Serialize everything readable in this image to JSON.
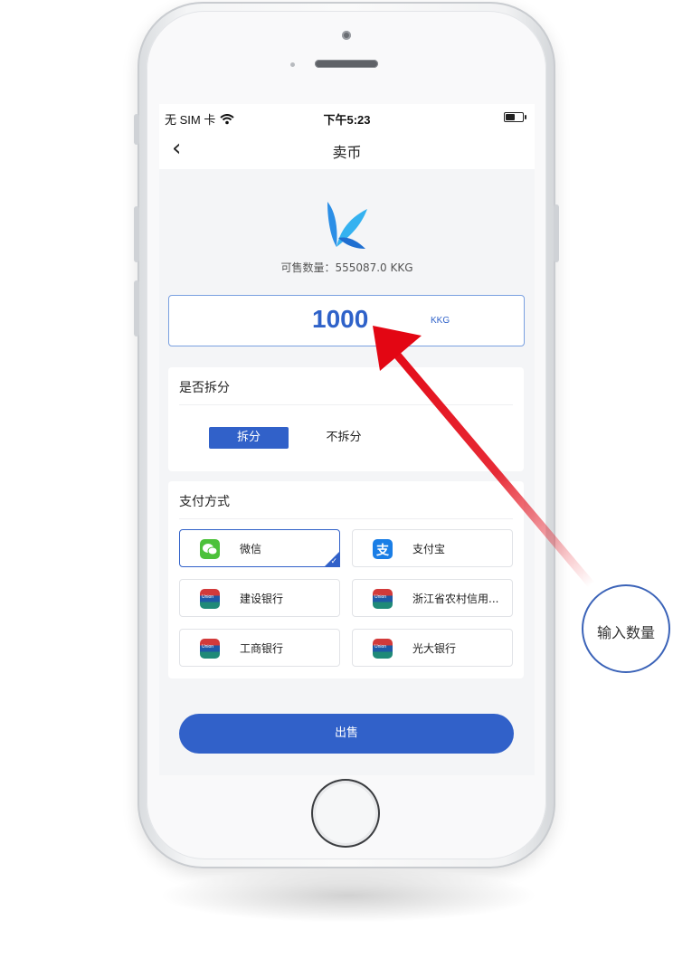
{
  "status_bar": {
    "carrier": "无 SIM 卡",
    "time": "下午5:23",
    "battery_level": 0.55
  },
  "navbar": {
    "back_icon": "chevron-left-icon",
    "title": "卖币"
  },
  "balance": {
    "available_text": "可售数量：555087.0 KKG"
  },
  "amount": {
    "value": "1000",
    "unit": "KKG"
  },
  "split": {
    "title": "是否拆分",
    "options": [
      "拆分",
      "不拆分"
    ],
    "selected": "拆分"
  },
  "payment": {
    "title": "支付方式",
    "methods": [
      {
        "label": "微信",
        "icon": "wechat-icon",
        "selected": true
      },
      {
        "label": "支付宝",
        "icon": "alipay-icon",
        "selected": false
      },
      {
        "label": "建设银行",
        "icon": "unionpay-icon",
        "selected": false
      },
      {
        "label": "浙江省农村信用...",
        "icon": "unionpay-icon",
        "selected": false
      },
      {
        "label": "工商银行",
        "icon": "unionpay-icon",
        "selected": false
      },
      {
        "label": "光大银行",
        "icon": "unionpay-icon",
        "selected": false
      }
    ]
  },
  "sell_button": {
    "label": "出售"
  },
  "annotation": {
    "text": "输入数量"
  },
  "colors": {
    "primary": "#3161c9",
    "wechat": "#4cc13a",
    "alipay": "#1a7ee6",
    "arrow": "#e30613"
  }
}
